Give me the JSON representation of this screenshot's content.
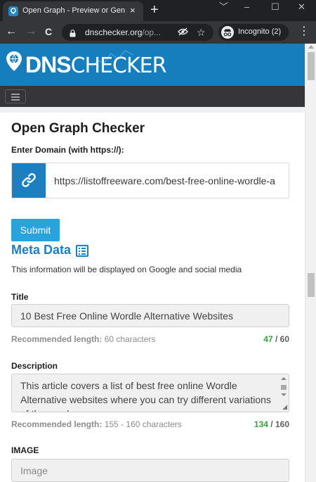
{
  "browser": {
    "tab_title": "Open Graph - Preview or Gen",
    "tab_close": "×",
    "new_tab": "+",
    "window_controls": [
      "﹀",
      "–",
      "☐",
      "✕"
    ],
    "back": "←",
    "forward": "→",
    "reload": "C",
    "url_host": "dnschecker.org",
    "url_path": "/op...",
    "incognito_label": "Incognito (2)",
    "menu": "⋮"
  },
  "site": {
    "logo_bold": "DNS",
    "logo_thin": "CHECKER",
    "brand_color": "#177ebd"
  },
  "main": {
    "title": "Open Graph Checker",
    "domain_label": "Enter Domain (with https://):",
    "domain_value": "https://listoffreeware.com/best-free-online-wordle-a",
    "submit_label": "Submit",
    "meta_title": "Meta Data",
    "meta_description": "This information will be displayed on Google and social media",
    "fields": {
      "title": {
        "label": "Title",
        "value": "10 Best Free Online Wordle Alternative Websites",
        "rec_label": "Recommended length:",
        "rec_value": "60 characters",
        "count": "47",
        "max": "60"
      },
      "description": {
        "label": "Description",
        "value": "This article covers a list of best free online Wordle Alternative websites where you can try different variations of the word",
        "rec_label": "Recommended length:",
        "rec_value": "155 - 160 characters",
        "count": "134",
        "max": "160"
      },
      "image": {
        "label": "IMAGE",
        "placeholder": "Image"
      }
    }
  },
  "colors": {
    "accent": "#1b7fc2",
    "submit": "#29a3dc",
    "count_ok": "#37a13d"
  }
}
